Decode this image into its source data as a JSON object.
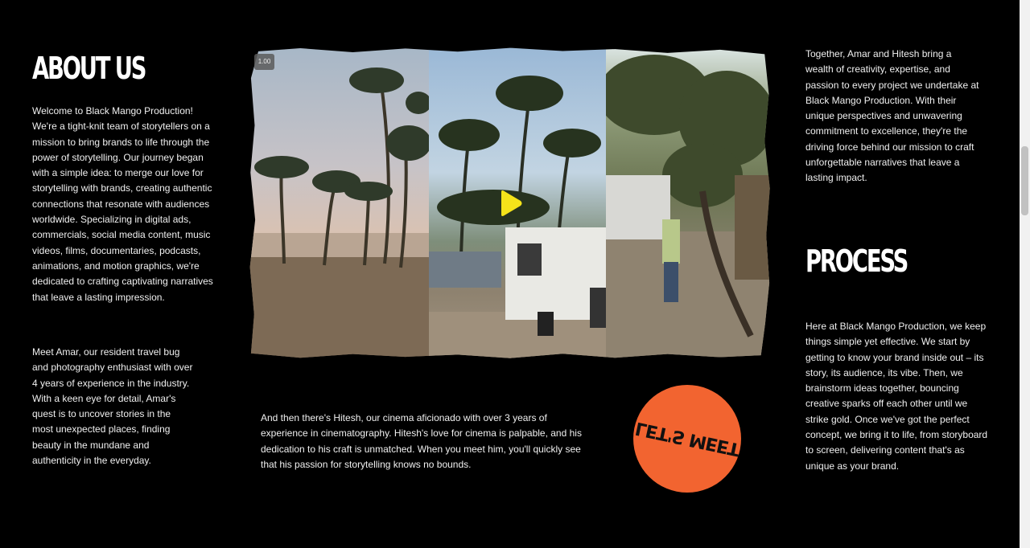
{
  "about": {
    "title": "ABOUT US",
    "intro": "Welcome to Black Mango Production! We're a tight-knit team of storytellers on a mission to bring brands to life through the power of storytelling. Our journey began with a simple idea: to merge our love for storytelling with brands, creating authentic connections that resonate with audiences worldwide. Specializing in digital ads, commercials, social media content, music videos, films, documentaries, podcasts, animations, and motion graphics, we're dedicated to crafting captivating narratives that leave a lasting impression.",
    "amar": "Meet Amar, our resident travel bug and photography enthusiast with over 4 years of experience in the industry. With a keen eye for detail, Amar's quest is to uncover stories in the most unexpected places, finding beauty in the mundane and authenticity in the everyday."
  },
  "media": {
    "version_badge": "1.00",
    "play_icon": "play-icon",
    "colors": {
      "play": "#f5e31a"
    }
  },
  "hitesh": "And then there's Hitesh, our cinema aficionado with over 3 years of experience in cinematography. Hitesh's love for cinema is palpable, and his dedication to his craft is unmatched. When you meet him, you'll quickly see that his passion for storytelling knows no bounds.",
  "cta": {
    "label": "LET'S MEET",
    "color": "#f26430"
  },
  "together": "Together, Amar and Hitesh bring a wealth of creativity, expertise, and passion to every project we undertake at Black Mango Production. With their unique perspectives and unwavering commitment to excellence, they're the driving force behind our mission to craft unforgettable narratives that leave a lasting impact.",
  "process": {
    "title": "PROCESS",
    "text": "Here at Black Mango Production, we keep things simple yet effective. We start by getting to know your brand inside out – its story, its audience, its vibe. Then, we brainstorm ideas together, bouncing creative sparks off each other until we strike gold. Once we've got the perfect concept, we bring it to life, from storyboard to screen, delivering content that's as unique as your brand."
  }
}
